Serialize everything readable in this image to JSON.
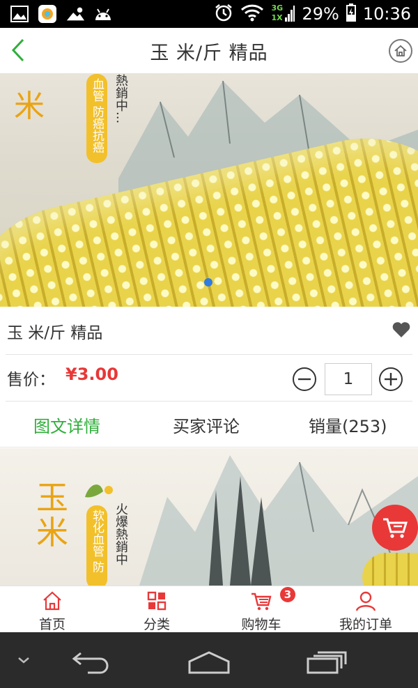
{
  "status_bar": {
    "battery": "29%",
    "time": "10:36",
    "network": "3G",
    "network2": "1X"
  },
  "header": {
    "title": "玉 米/斤 精品"
  },
  "hero": {
    "vertical_tag": "血管 防癌抗癌",
    "side_text": "熱銷中..."
  },
  "product": {
    "name": "玉 米/斤 精品",
    "price_label": "售价：",
    "price": "¥3.00",
    "quantity": "1"
  },
  "tabs": [
    {
      "label": "图文详情",
      "active": true
    },
    {
      "label": "买家评论",
      "active": false
    },
    {
      "label": "销量(253)",
      "active": false
    }
  ],
  "detail": {
    "title_char1": "玉",
    "title_char2": "米",
    "vertical_tag": "软化血管 防",
    "side_text": "火爆熱銷中"
  },
  "bottom_nav": [
    {
      "label": "首页",
      "icon": "home-icon"
    },
    {
      "label": "分类",
      "icon": "grid-icon"
    },
    {
      "label": "购物车",
      "icon": "cart-icon"
    },
    {
      "label": "我的订单",
      "icon": "user-icon"
    }
  ],
  "cart_badge": "3",
  "colors": {
    "accent_green": "#2fae3a",
    "price_red": "#e83737",
    "badge_red": "#e93838"
  }
}
